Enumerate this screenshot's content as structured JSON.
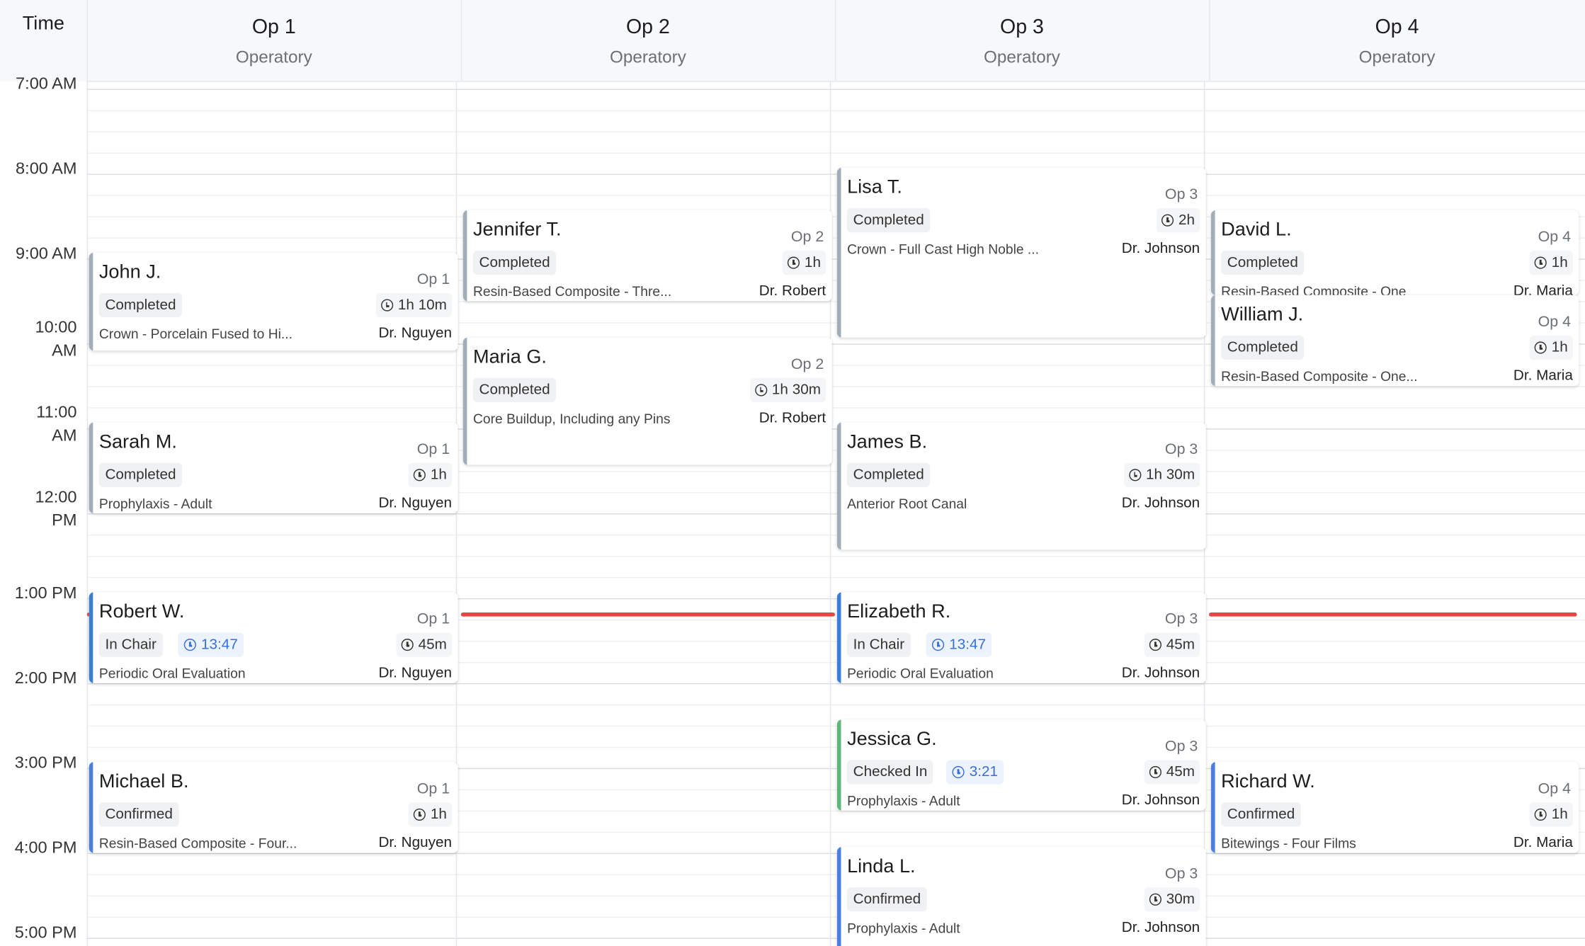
{
  "header": {
    "time_label": "Time",
    "operatories": [
      {
        "title": "Op 1",
        "subtitle": "Operatory"
      },
      {
        "title": "Op 2",
        "subtitle": "Operatory"
      },
      {
        "title": "Op 3",
        "subtitle": "Operatory"
      },
      {
        "title": "Op 4",
        "subtitle": "Operatory"
      }
    ]
  },
  "time_slots": [
    "7:00 AM",
    "8:00 AM",
    "9:00 AM",
    "10:00",
    "AM",
    "11:00",
    "AM",
    "12:00",
    "PM",
    "1:00 PM",
    "2:00 PM",
    "3:00 PM",
    "4:00 PM",
    "5:00 PM"
  ],
  "colors": {
    "completed": "#a3adb8",
    "in_chair": "#3b7fd4",
    "checked_in": "#5cb87a",
    "confirmed": "#4a7fe0",
    "now_line": "#e0484a",
    "timer_text": "#3a6fd8"
  },
  "appointments": [
    {
      "patient": "John J.",
      "op": "Op 1",
      "status": "Completed",
      "duration": "1h 10m",
      "procedure": "Crown - Porcelain Fused to Hi...",
      "doctor": "Dr. Nguyen",
      "status_color": "#a3adb8",
      "icon": "clock-icon"
    },
    {
      "patient": "Sarah M.",
      "op": "Op 1",
      "status": "Completed",
      "duration": "1h",
      "procedure": "Prophylaxis - Adult",
      "doctor": "Dr. Nguyen",
      "status_color": "#a3adb8",
      "icon": "clock-icon"
    },
    {
      "patient": "Robert W.",
      "op": "Op 1",
      "status": "In Chair",
      "timer": "13:47",
      "duration": "45m",
      "procedure": "Periodic Oral Evaluation",
      "doctor": "Dr. Nguyen",
      "status_color": "#3b7fd4",
      "icon": "clock-icon"
    },
    {
      "patient": "Michael B.",
      "op": "Op 1",
      "status": "Confirmed",
      "duration": "1h",
      "procedure": "Resin-Based Composite - Four...",
      "doctor": "Dr. Nguyen",
      "status_color": "#4a7fe0",
      "icon": "clock-icon"
    },
    {
      "patient": "Jennifer T.",
      "op": "Op 2",
      "status": "Completed",
      "duration": "1h",
      "procedure": "Resin-Based Composite - Thre...",
      "doctor": "Dr. Robert",
      "status_color": "#a3adb8",
      "icon": "clock-icon"
    },
    {
      "patient": "Maria G.",
      "op": "Op 2",
      "status": "Completed",
      "duration": "1h 30m",
      "procedure": "Core Buildup, Including any Pins",
      "doctor": "Dr. Robert",
      "status_color": "#a3adb8",
      "icon": "clock-icon"
    },
    {
      "patient": "Lisa T.",
      "op": "Op 3",
      "status": "Completed",
      "duration": "2h",
      "procedure": "Crown - Full Cast High Noble ...",
      "doctor": "Dr. Johnson",
      "status_color": "#a3adb8",
      "icon": "clock-icon"
    },
    {
      "patient": "James B.",
      "op": "Op 3",
      "status": "Completed",
      "duration": "1h 30m",
      "procedure": "Anterior Root Canal",
      "doctor": "Dr. Johnson",
      "status_color": "#a3adb8",
      "icon": "clock-icon"
    },
    {
      "patient": "Elizabeth R.",
      "op": "Op 3",
      "status": "In Chair",
      "timer": "13:47",
      "duration": "45m",
      "procedure": "Periodic Oral Evaluation",
      "doctor": "Dr. Johnson",
      "status_color": "#3b7fd4",
      "icon": "clock-icon"
    },
    {
      "patient": "Jessica G.",
      "op": "Op 3",
      "status": "Checked In",
      "timer": "3:21",
      "duration": "45m",
      "procedure": "Prophylaxis - Adult",
      "doctor": "Dr. Johnson",
      "status_color": "#5cb87a",
      "icon": "clock-icon"
    },
    {
      "patient": "Linda L.",
      "op": "Op 3",
      "status": "Confirmed",
      "duration": "30m",
      "procedure": "Prophylaxis - Adult",
      "doctor": "Dr. Johnson",
      "status_color": "#4a7fe0",
      "icon": "clock-icon"
    },
    {
      "patient": "David L.",
      "op": "Op 4",
      "status": "Completed",
      "duration": "1h",
      "procedure": "Resin-Based Composite - One",
      "doctor": "Dr. Maria",
      "status_color": "#a3adb8",
      "icon": "clock-icon"
    },
    {
      "patient": "William J.",
      "op": "Op 4",
      "status": "Completed",
      "duration": "1h",
      "procedure": "Resin-Based Composite - One...",
      "doctor": "Dr. Maria",
      "status_color": "#a3adb8",
      "icon": "clock-icon"
    },
    {
      "patient": "Richard W.",
      "op": "Op 4",
      "status": "Confirmed",
      "duration": "1h",
      "procedure": "Bitewings - Four Films",
      "doctor": "Dr. Maria",
      "status_color": "#4a7fe0",
      "icon": "clock-icon"
    }
  ]
}
